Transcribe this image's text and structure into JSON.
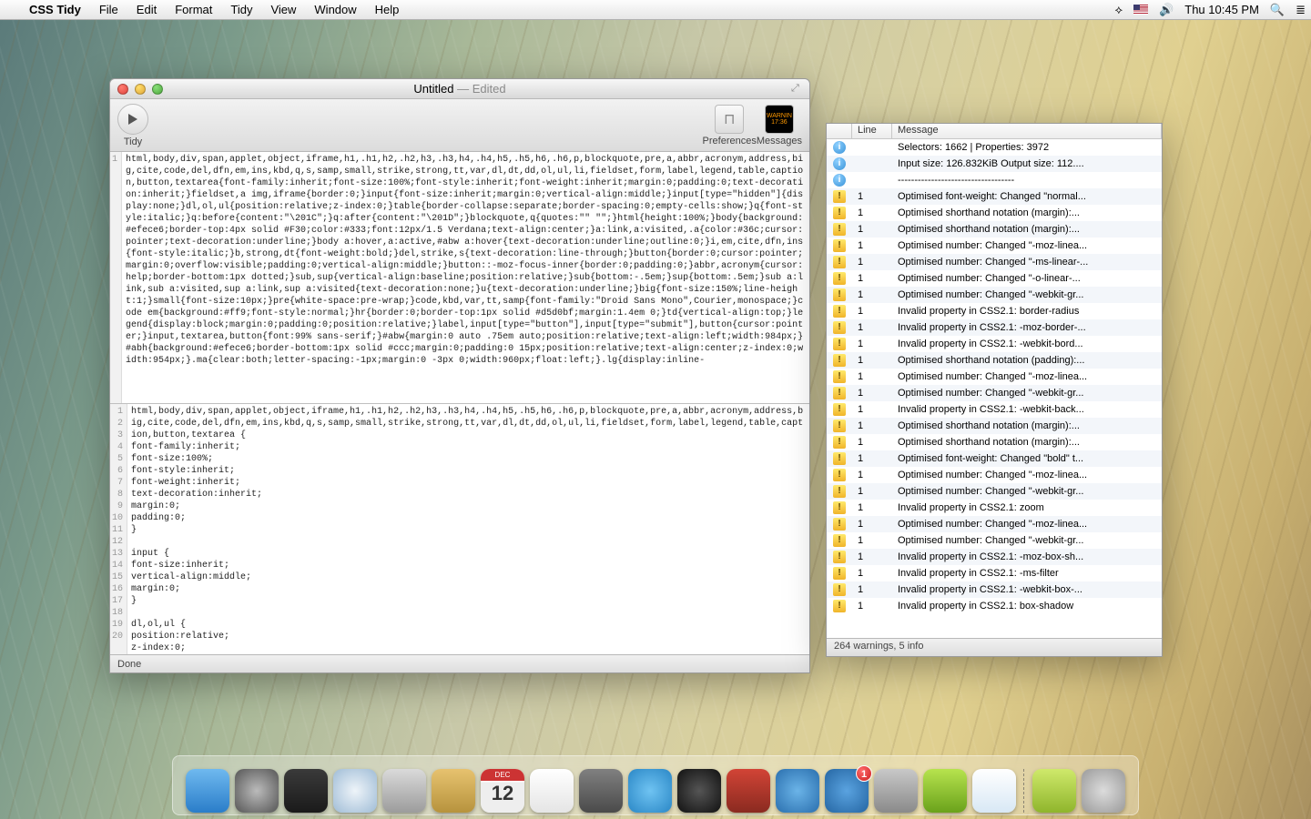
{
  "menubar": {
    "app": "CSS Tidy",
    "items": [
      "File",
      "Edit",
      "Format",
      "Tidy",
      "View",
      "Window",
      "Help"
    ],
    "clock": "Thu 10:45 PM"
  },
  "window": {
    "title": "Untitled",
    "subtitle": " — Edited",
    "toolbar": {
      "tidy": "Tidy",
      "preferences": "Preferences",
      "messages": "Messages",
      "warn1": "WARNIN",
      "warn2": "17:36"
    },
    "status": "Done",
    "topGutter": "1",
    "topCode": "html,body,div,span,applet,object,iframe,h1,.h1,h2,.h2,h3,.h3,h4,.h4,h5,.h5,h6,.h6,p,blockquote,pre,a,abbr,acronym,address,big,cite,code,del,dfn,em,ins,kbd,q,s,samp,small,strike,strong,tt,var,dl,dt,dd,ol,ul,li,fieldset,form,label,legend,table,caption,button,textarea{font-family:inherit;font-size:100%;font-style:inherit;font-weight:inherit;margin:0;padding:0;text-decoration:inherit;}fieldset,a img,iframe{border:0;}input{font-size:inherit;margin:0;vertical-align:middle;}input[type=\"hidden\"]{display:none;}dl,ol,ul{position:relative;z-index:0;}table{border-collapse:separate;border-spacing:0;empty-cells:show;}q{font-style:italic;}q:before{content:\"\\201C\";}q:after{content:\"\\201D\";}blockquote,q{quotes:\"\" \"\";}html{height:100%;}body{background:#efece6;border-top:4px solid #F30;color:#333;font:12px/1.5 Verdana;text-align:center;}a:link,a:visited,.a{color:#36c;cursor:pointer;text-decoration:underline;}body a:hover,a:active,#abw a:hover{text-decoration:underline;outline:0;}i,em,cite,dfn,ins{font-style:italic;}b,strong,dt{font-weight:bold;}del,strike,s{text-decoration:line-through;}button{border:0;cursor:pointer;margin:0;overflow:visible;padding:0;vertical-align:middle;}button::-moz-focus-inner{border:0;padding:0;}abbr,acronym{cursor:help;border-bottom:1px dotted;}sub,sup{vertical-align:baseline;position:relative;}sub{bottom:-.5em;}sup{bottom:.5em;}sub a:link,sub a:visited,sup a:link,sup a:visited{text-decoration:none;}u{text-decoration:underline;}big{font-size:150%;line-height:1;}small{font-size:10px;}pre{white-space:pre-wrap;}code,kbd,var,tt,samp{font-family:\"Droid Sans Mono\",Courier,monospace;}code em{background:#ff9;font-style:normal;}hr{border:0;border-top:1px solid #d5d0bf;margin:1.4em 0;}td{vertical-align:top;}legend{display:block;margin:0;padding:0;position:relative;}label,input[type=\"button\"],input[type=\"submit\"],button{cursor:pointer;}input,textarea,button{font:99% sans-serif;}#abw{margin:0 auto .75em auto;position:relative;text-align:left;width:984px;}#abh{background:#efece6;border-bottom:1px solid #ccc;margin:0;padding:0 15px;position:relative;text-align:center;z-index:0;width:954px;}.ma{clear:both;letter-spacing:-1px;margin:0 -3px 0;width:960px;float:left;}.lg{display:inline-",
    "botGutter": " 1\n 2\n 3\n 4\n 5\n 6\n 7\n 8\n 9\n10\n11\n12\n13\n14\n15\n16\n17\n18\n19\n20",
    "botCode": "html,body,div,span,applet,object,iframe,h1,.h1,h2,.h2,h3,.h3,h4,.h4,h5,.h5,h6,.h6,p,blockquote,pre,a,abbr,acronym,address,big,cite,code,del,dfn,em,ins,kbd,q,s,samp,small,strike,strong,tt,var,dl,dt,dd,ol,ul,li,fieldset,form,label,legend,table,caption,button,textarea {\nfont-family:inherit;\nfont-size:100%;\nfont-style:inherit;\nfont-weight:inherit;\ntext-decoration:inherit;\nmargin:0;\npadding:0;\n}\n\ninput {\nfont-size:inherit;\nvertical-align:middle;\nmargin:0;\n}\n\ndl,ol,ul {\nposition:relative;\nz-index:0;\n}"
  },
  "messages": {
    "headers": {
      "line": "Line",
      "message": "Message"
    },
    "rows": [
      {
        "t": "info",
        "ln": "",
        "m": "Selectors: 1662 | Properties: 3972"
      },
      {
        "t": "info",
        "ln": "",
        "m": "Input size: 126.832KiB  Output size: 112...."
      },
      {
        "t": "info",
        "ln": "",
        "m": "-----------------------------------"
      },
      {
        "t": "warn",
        "ln": "1",
        "m": "Optimised font-weight: Changed \"normal..."
      },
      {
        "t": "warn",
        "ln": "1",
        "m": "Optimised shorthand notation (margin):..."
      },
      {
        "t": "warn",
        "ln": "1",
        "m": "Optimised shorthand notation (margin):..."
      },
      {
        "t": "warn",
        "ln": "1",
        "m": "Optimised number: Changed \"-moz-linea..."
      },
      {
        "t": "warn",
        "ln": "1",
        "m": "Optimised number: Changed \"-ms-linear-..."
      },
      {
        "t": "warn",
        "ln": "1",
        "m": "Optimised number: Changed \"-o-linear-..."
      },
      {
        "t": "warn",
        "ln": "1",
        "m": "Optimised number: Changed \"-webkit-gr..."
      },
      {
        "t": "warn",
        "ln": "1",
        "m": "Invalid property in CSS2.1: border-radius"
      },
      {
        "t": "warn",
        "ln": "1",
        "m": "Invalid property in CSS2.1: -moz-border-..."
      },
      {
        "t": "warn",
        "ln": "1",
        "m": "Invalid property in CSS2.1: -webkit-bord..."
      },
      {
        "t": "warn",
        "ln": "1",
        "m": "Optimised shorthand notation (padding):..."
      },
      {
        "t": "warn",
        "ln": "1",
        "m": "Optimised number: Changed \"-moz-linea..."
      },
      {
        "t": "warn",
        "ln": "1",
        "m": "Optimised number: Changed \"-webkit-gr..."
      },
      {
        "t": "warn",
        "ln": "1",
        "m": "Invalid property in CSS2.1: -webkit-back..."
      },
      {
        "t": "warn",
        "ln": "1",
        "m": "Optimised shorthand notation (margin):..."
      },
      {
        "t": "warn",
        "ln": "1",
        "m": "Optimised shorthand notation (margin):..."
      },
      {
        "t": "warn",
        "ln": "1",
        "m": "Optimised font-weight: Changed \"bold\" t..."
      },
      {
        "t": "warn",
        "ln": "1",
        "m": "Optimised number: Changed \"-moz-linea..."
      },
      {
        "t": "warn",
        "ln": "1",
        "m": "Optimised number: Changed \"-webkit-gr..."
      },
      {
        "t": "warn",
        "ln": "1",
        "m": "Invalid property in CSS2.1: zoom"
      },
      {
        "t": "warn",
        "ln": "1",
        "m": "Optimised number: Changed \"-moz-linea..."
      },
      {
        "t": "warn",
        "ln": "1",
        "m": "Optimised number: Changed \"-webkit-gr..."
      },
      {
        "t": "warn",
        "ln": "1",
        "m": "Invalid property in CSS2.1: -moz-box-sh..."
      },
      {
        "t": "warn",
        "ln": "1",
        "m": "Invalid property in CSS2.1: -ms-filter"
      },
      {
        "t": "warn",
        "ln": "1",
        "m": "Invalid property in CSS2.1: -webkit-box-..."
      },
      {
        "t": "warn",
        "ln": "1",
        "m": "Invalid property in CSS2.1: box-shadow"
      }
    ],
    "footer": "264 warnings, 5 info"
  },
  "dock": {
    "items": [
      {
        "name": "finder",
        "bg": "linear-gradient(#6fb9ef,#2a7dc9)"
      },
      {
        "name": "launchpad",
        "bg": "radial-gradient(circle,#bbb,#555)"
      },
      {
        "name": "mission-control",
        "bg": "linear-gradient(#3a3a3a,#1a1a1a)"
      },
      {
        "name": "safari",
        "bg": "radial-gradient(circle,#eef4f9,#9fbcd6)"
      },
      {
        "name": "mail",
        "bg": "linear-gradient(#dadada,#9c9c9c)"
      },
      {
        "name": "contacts",
        "bg": "linear-gradient(#e7c26f,#b7933d)"
      },
      {
        "name": "calendar",
        "bg": "linear-gradient(#fff 30%,#eee 30%)",
        "txt": "12",
        "top": "DEC"
      },
      {
        "name": "reminders",
        "bg": "linear-gradient(#fff,#e5e5e5)"
      },
      {
        "name": "preview",
        "bg": "linear-gradient(#808080,#4a4a4a)"
      },
      {
        "name": "messages",
        "bg": "radial-gradient(circle,#6fc3f2,#2a87c6)"
      },
      {
        "name": "facetime",
        "bg": "radial-gradient(circle,#555,#111)"
      },
      {
        "name": "photo-booth",
        "bg": "linear-gradient(#d24436,#8a2a20)"
      },
      {
        "name": "itunes",
        "bg": "radial-gradient(circle,#6bb4e8,#2a6fae)"
      },
      {
        "name": "app-store",
        "bg": "radial-gradient(circle,#5aa3e0,#2566a3)",
        "badge": "1"
      },
      {
        "name": "system-preferences",
        "bg": "linear-gradient(#c8c8c8,#8a8a8a)"
      },
      {
        "name": "archive-utility",
        "bg": "linear-gradient(#b7e34e,#6aa21b)"
      },
      {
        "name": "css-tidy-app",
        "bg": "linear-gradient(#fff,#d8e8f5)"
      }
    ],
    "right": [
      {
        "name": "downloads",
        "bg": "linear-gradient(#cfe96b,#8fb52c)"
      },
      {
        "name": "trash",
        "bg": "radial-gradient(circle,#dcdcdc,#9a9a9a)"
      }
    ]
  }
}
